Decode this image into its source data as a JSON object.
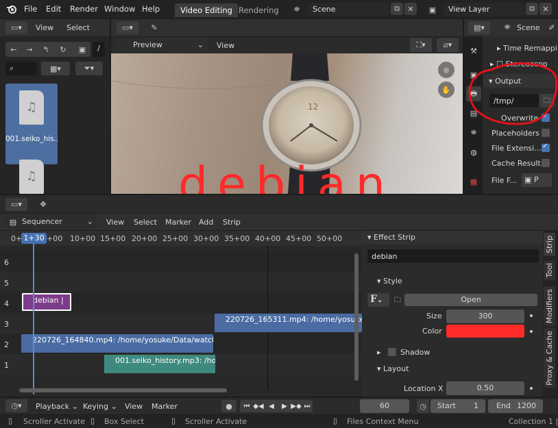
{
  "topbar": {
    "menus": [
      "File",
      "Edit",
      "Render",
      "Window",
      "Help"
    ],
    "workspaces": [
      "Video Editing",
      "Rendering"
    ],
    "scene_name": "Scene",
    "view_layer": "View Layer"
  },
  "file_browser": {
    "menus": [
      "View",
      "Select"
    ],
    "path_separator": "/",
    "files": [
      "001.seiko_his..."
    ]
  },
  "preview": {
    "mode": "Preview",
    "view_menu": "View",
    "overlay_text": "debian"
  },
  "properties": {
    "scene_tab": "Scene",
    "time_remap": "Time Remappi",
    "stereoscopy": "Stereoscop",
    "output_title": "Output",
    "output_path": "/tmp/",
    "overwrite": "Overwrite",
    "placeholders": "Placeholders",
    "file_extensions": "File Extensi...",
    "cache_result": "Cache Result",
    "file_format_label": "File F...",
    "file_format_value": "P"
  },
  "sequencer": {
    "editor": "Sequencer",
    "menus": [
      "View",
      "Select",
      "Marker",
      "Add",
      "Strip"
    ],
    "ruler": [
      "0+",
      "1+30",
      "+00",
      "10+00",
      "15+00",
      "20+00",
      "25+00",
      "30+00",
      "35+00",
      "40+00",
      "45+00",
      "50+00"
    ],
    "channels": [
      "6",
      "5",
      "4",
      "3",
      "2",
      "1"
    ],
    "strips": {
      "text": "debian |",
      "movie_a": "220726_165311.mp4: /home/yosuke",
      "movie_b": "220726_164840.mp4: /home/yosuke/Data/watch",
      "sound": "001.seiko_history.mp3: /ho"
    }
  },
  "sidebar": {
    "panel_title": "Effect Strip",
    "strip_name": "debian",
    "style_title": "Style",
    "open_button": "Open",
    "size_label": "Size",
    "size_value": "300",
    "color_label": "Color",
    "text_color": "#ff2a2a",
    "shadow_label": "Shadow",
    "layout_title": "Layout",
    "location_x_label": "Location X",
    "location_x_value": "0.50",
    "tabs": [
      "Strip",
      "Tool",
      "Modifiers",
      "Proxy & Cache"
    ]
  },
  "timeline": {
    "menus": [
      "Playback",
      "Keying",
      "View",
      "Marker"
    ],
    "current_frame": "60",
    "start_label": "Start",
    "start_value": "1",
    "end_label": "End",
    "end_value": "1200"
  },
  "status": {
    "items": [
      "Scroller Activate",
      "Box Select",
      "Scroller Activate",
      "Files Context Menu"
    ],
    "collection": "Collection 1 | "
  }
}
